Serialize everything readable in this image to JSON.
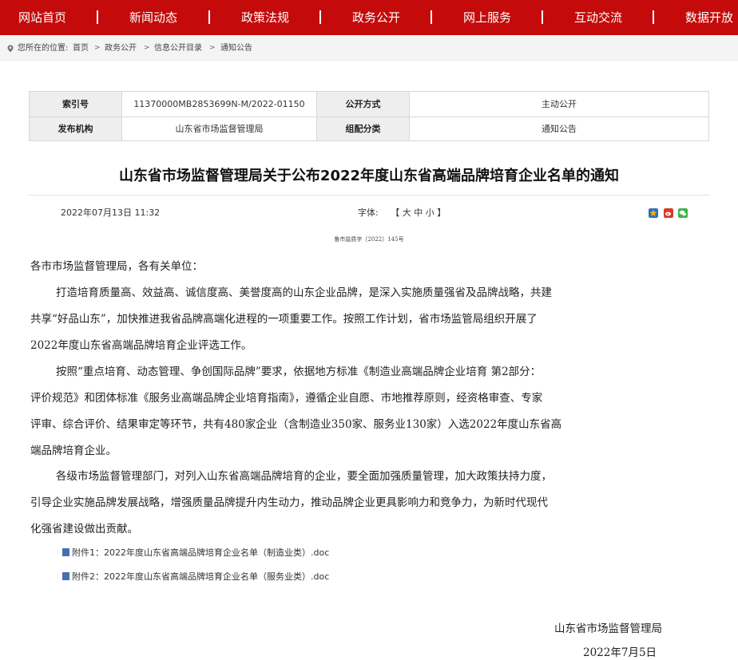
{
  "nav": [
    "网站首页",
    "新闻动态",
    "政策法规",
    "政务公开",
    "网上服务",
    "互动交流",
    "数据开放"
  ],
  "breadcrumb": {
    "label": "您所在的位置:",
    "items": [
      "首页",
      "政务公开",
      "信息公开目录",
      "通知公告"
    ]
  },
  "info": {
    "index_label": "索引号",
    "index_value": "11370000MB2853699N-M/2022-01150",
    "method_label": "公开方式",
    "method_value": "主动公开",
    "org_label": "发布机构",
    "org_value": "山东省市场监督管理局",
    "category_label": "组配分类",
    "category_value": "通知公告"
  },
  "title": "山东省市场监督管理局关于公布2022年度山东省高端品牌培育企业名单的通知",
  "meta": {
    "date": "2022年07月13日 11:32",
    "font_label": "字体:",
    "font_open": "【",
    "font_large": "大",
    "font_medium": "中",
    "font_small": "小",
    "font_close": "】"
  },
  "doc_number": "鲁市监质字〔2022〕145号",
  "body": {
    "salutation": "各市市场监督管理局，各有关单位：",
    "p1": [
      "打造培育质量高、效益高、诚信度高、美誉度高的山东企业品牌，是深入实施质量强省及品牌战略，共建",
      "共享“好品山东”，加快推进我省品牌高端化进程的一项重要工作。按照工作计划，省市场监管局组织开展了",
      "2022年度山东省高端品牌培育企业评选工作。"
    ],
    "p2": [
      "按照“重点培育、动态管理、争创国际品牌”要求，依据地方标准《制造业高端品牌企业培育  第2部分：",
      "评价规范》和团体标准《服务业高端品牌企业培育指南》，遵循企业自愿、市地推荐原则，经资格审查、专家",
      "评审、综合评价、结果审定等环节，共有480家企业（含制造业350家、服务业130家）入选2022年度山东省高",
      "端品牌培育企业。"
    ],
    "p3": [
      "各级市场监督管理部门，对列入山东省高端品牌培育的企业，要全面加强质量管理，加大政策扶持力度，",
      "引导企业实施品牌发展战略，增强质量品牌提升内生动力，推动品牌企业更具影响力和竞争力，为新时代现代",
      "化强省建设做出贡献。"
    ]
  },
  "attachments": [
    "附件1：2022年度山东省高端品牌培育企业名单（制造业类）.doc",
    "附件2：2022年度山东省高端品牌培育企业名单（服务业类）.doc"
  ],
  "signature": {
    "org": "山东省市场监督管理局",
    "date": "2022年7月5日"
  },
  "colors": {
    "nav_bg": "#c40a0a",
    "share_star": "#f0b400",
    "share_weibo": "#d9382b",
    "share_wechat": "#3bb34a"
  },
  "icons": [
    "location-icon",
    "share-favorite-icon",
    "share-weibo-icon",
    "share-wechat-icon",
    "doc-file-icon"
  ]
}
